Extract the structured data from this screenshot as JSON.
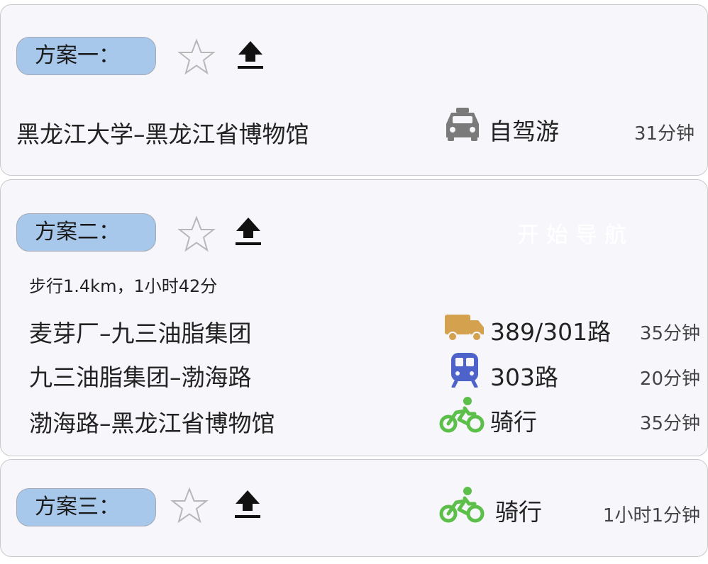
{
  "plans": [
    {
      "label": "方案一：",
      "legs": [
        {
          "route": "黑龙江大学–黑龙江省博物馆",
          "mode": "自驾游",
          "mode_icon": "car-icon",
          "duration": "31分钟"
        }
      ]
    },
    {
      "label": "方案二：",
      "summary": "步行1.4km，1小时42分",
      "nav_button": "开始导航",
      "legs": [
        {
          "route": "麦芽厂–九三油脂集团",
          "mode": "389/301路",
          "mode_icon": "bus-truck-icon",
          "duration": "35分钟"
        },
        {
          "route": "九三油脂集团–渤海路",
          "mode": "303路",
          "mode_icon": "train-icon",
          "duration": "20分钟"
        },
        {
          "route": "渤海路–黑龙江省博物馆",
          "mode": "骑行",
          "mode_icon": "bicycle-icon",
          "duration": "35分钟"
        }
      ]
    },
    {
      "label": "方案三：",
      "legs": [
        {
          "mode": "骑行",
          "mode_icon": "bicycle-icon",
          "duration": "1小时1分钟"
        }
      ]
    }
  ],
  "colors": {
    "pill_bg": "#a7c8eb",
    "car": "#7a7a7a",
    "truck": "#d4a24f",
    "train": "#4d63c9",
    "bike": "#5bbf4a"
  }
}
